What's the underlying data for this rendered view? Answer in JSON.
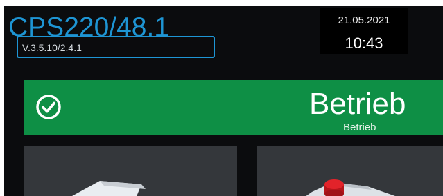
{
  "header": {
    "device_title": "CPS220/48.1",
    "version": "V.3.5.10/2.4.1"
  },
  "clock": {
    "date": "21.05.2021",
    "time": "10:43"
  },
  "status": {
    "title": "Betrieb",
    "subtitle": "Betrieb",
    "icon": "check-circle-icon",
    "color": "#0e8f45"
  },
  "tiles": [
    {
      "icon": "battery-module-icon"
    },
    {
      "icon": "device-red-button-icon"
    }
  ],
  "colors": {
    "accent": "#1e95d4",
    "background": "#0b0c0e",
    "tile": "#34373b"
  }
}
